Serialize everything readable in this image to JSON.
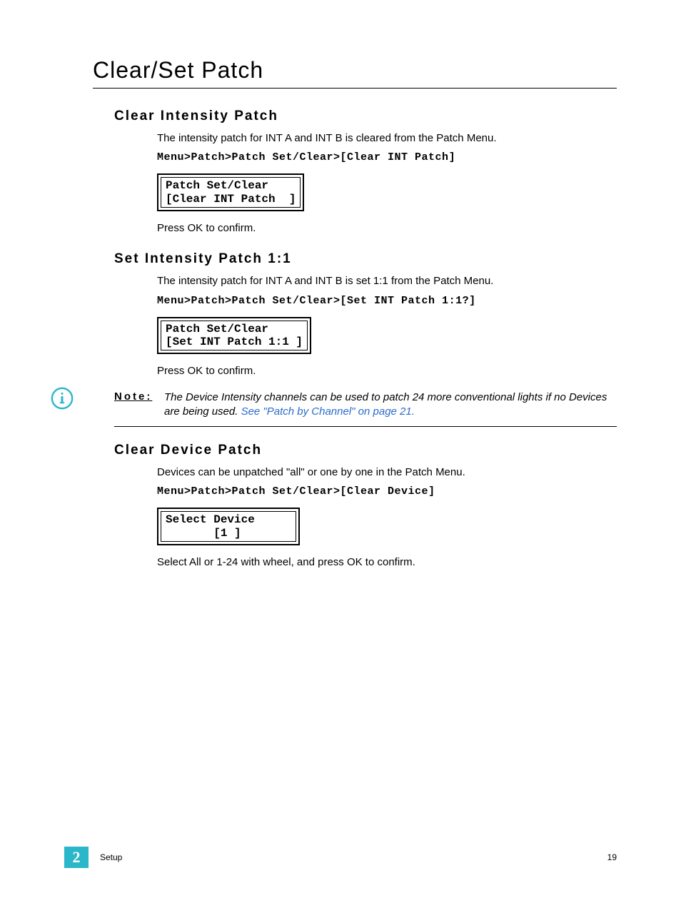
{
  "page_title": "Clear/Set Patch",
  "sections": {
    "s1": {
      "heading": "Clear Intensity Patch",
      "body": "The intensity patch for INT A and INT B is cleared from the Patch Menu.",
      "menu_path": "Menu>Patch>Patch Set/Clear>[Clear INT Patch]",
      "lcd_line1": "Patch Set/Clear",
      "lcd_line2": "[Clear INT Patch  ]",
      "confirm": "Press OK to confirm."
    },
    "s2": {
      "heading": "Set Intensity Patch 1:1",
      "body": "The intensity patch for INT A and INT B is set 1:1 from the Patch Menu.",
      "menu_path": "Menu>Patch>Patch Set/Clear>[Set INT Patch 1:1?]",
      "lcd_line1": "Patch Set/Clear",
      "lcd_line2": "[Set INT Patch 1:1 ]",
      "confirm": "Press OK to confirm."
    },
    "note": {
      "label": "Note:",
      "text": "The Device Intensity channels can be used to patch 24 more conventional lights if no Devices are being used. ",
      "link": "See \"Patch by Channel\" on page 21."
    },
    "s3": {
      "heading": "Clear Device Patch",
      "body": "Devices can be unpatched \"all\" or one by one in the Patch Menu.",
      "menu_path": "Menu>Patch>Patch Set/Clear>[Clear Device]",
      "lcd_line1": "Select Device",
      "lcd_line2": "       [1 ]",
      "confirm": "Select All or 1-24 with wheel, and press OK to confirm."
    }
  },
  "footer": {
    "chapter_num": "2",
    "chapter_label": "Setup",
    "page_num": "19"
  }
}
